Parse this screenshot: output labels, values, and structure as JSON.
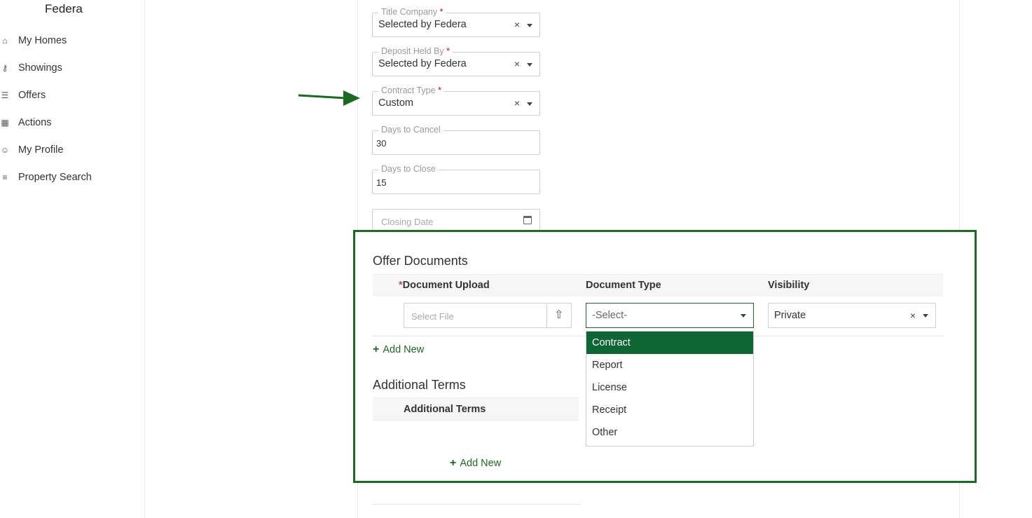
{
  "sidebar": {
    "brand": "Federa",
    "items": [
      {
        "label": "My Homes",
        "icon": "home-icon"
      },
      {
        "label": "Showings",
        "icon": "key-icon"
      },
      {
        "label": "Offers",
        "icon": "document-icon"
      },
      {
        "label": "Actions",
        "icon": "calendar-icon"
      },
      {
        "label": "My Profile",
        "icon": "face-icon"
      },
      {
        "label": "Property Search",
        "icon": "search-list-icon"
      }
    ]
  },
  "form": {
    "title_company": {
      "label": "Title Company",
      "required": "*",
      "value": "Selected by Federa"
    },
    "deposit_held_by": {
      "label": "Deposit Held By",
      "required": "*",
      "value": "Selected by Federa"
    },
    "contract_type": {
      "label": "Contract Type",
      "required": "*",
      "value": "Custom"
    },
    "days_to_cancel": {
      "label": "Days to Cancel",
      "value": "30"
    },
    "days_to_close": {
      "label": "Days to Close",
      "value": "15"
    },
    "closing_date": {
      "placeholder": "Closing Date"
    },
    "clear_glyph": "×"
  },
  "offer_documents": {
    "title": "Offer Documents",
    "columns": {
      "upload_required": "*",
      "upload": "Document Upload",
      "type": "Document Type",
      "visibility": "Visibility"
    },
    "row": {
      "file_placeholder": "Select File",
      "type_value": "-Select-",
      "visibility_value": "Private"
    },
    "type_options": [
      "Contract",
      "Report",
      "License",
      "Receipt",
      "Other"
    ],
    "active_option": "Contract",
    "add_new": "Add New"
  },
  "additional_terms": {
    "title": "Additional Terms",
    "column": "Additional Terms",
    "add_new": "Add New"
  },
  "colors": {
    "accent": "#1a6b21",
    "active_option": "#0d6533",
    "required": "#d0021b"
  }
}
